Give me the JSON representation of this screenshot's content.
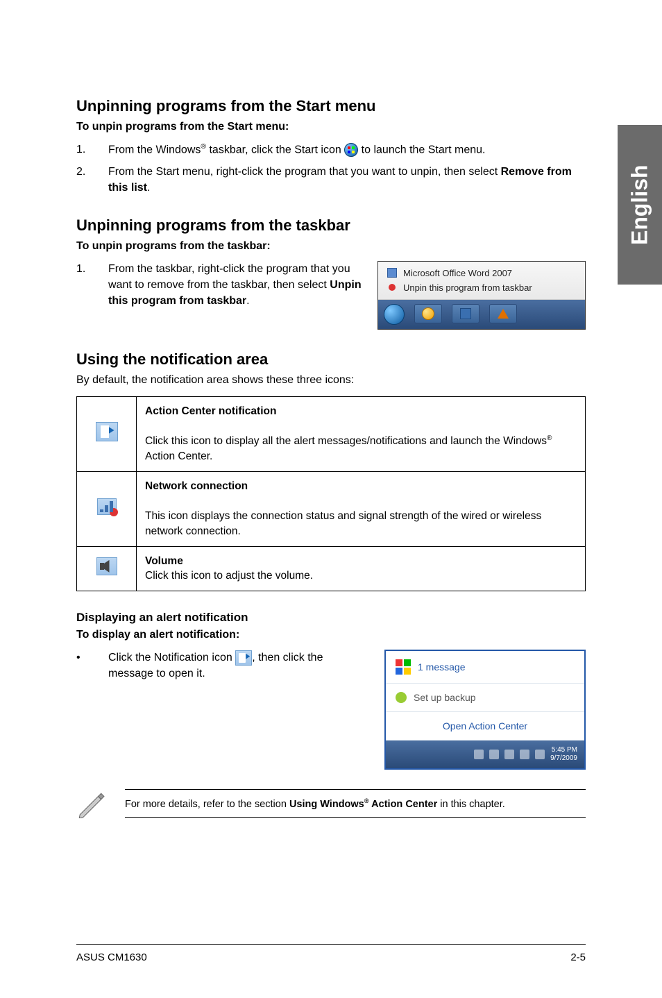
{
  "sideTab": "English",
  "sec1": {
    "heading": "Unpinning programs from the Start menu",
    "subline": "To unpin programs from the Start menu:",
    "step1_a": "From the Windows",
    "step1_b": " taskbar, click the Start icon ",
    "step1_c": " to launch the Start menu.",
    "step2_a": "From the Start menu, right-click the program that you want to unpin, then select ",
    "step2_b": "Remove from this list",
    "step2_c": "."
  },
  "sec2": {
    "heading": "Unpinning programs from the taskbar",
    "subline": "To unpin programs from the taskbar:",
    "step1_a": "From the taskbar, right-click the program that you want to remove from the taskbar, then select ",
    "step1_b": "Unpin this program from taskbar",
    "step1_c": ".",
    "img": {
      "item1": "Microsoft Office Word 2007",
      "item2": "Unpin this program from taskbar"
    }
  },
  "sec3": {
    "heading": "Using the notification area",
    "intro": "By default, the notification area shows these three icons:",
    "row1_title": "Action Center notification",
    "row1_body_a": "Click this icon to display all the alert messages/notifications and launch the Windows",
    "row1_body_b": " Action Center.",
    "row2_title": "Network connection",
    "row2_body": "This icon displays the connection status and signal strength of the wired or wireless network connection.",
    "row3_title": "Volume",
    "row3_body": "Click this icon to adjust the volume."
  },
  "sec4": {
    "heading": "Displaying an alert notification",
    "subline": "To display an alert notification:",
    "bullet_a": "Click the Notification icon ",
    "bullet_b": ", then click the message to open it.",
    "img": {
      "msg": "1 message",
      "backup": "Set up backup",
      "open": "Open Action Center",
      "time": "5:45 PM",
      "date": "9/7/2009"
    }
  },
  "note_a": "For more details, refer to the section ",
  "note_b": "Using Windows",
  "note_c": " Action Center",
  "note_d": " in this chapter.",
  "footer": {
    "left": "ASUS CM1630",
    "right": "2-5"
  },
  "numbers": {
    "one": "1.",
    "two": "2."
  },
  "bullet_dot": "•",
  "reg": "®"
}
